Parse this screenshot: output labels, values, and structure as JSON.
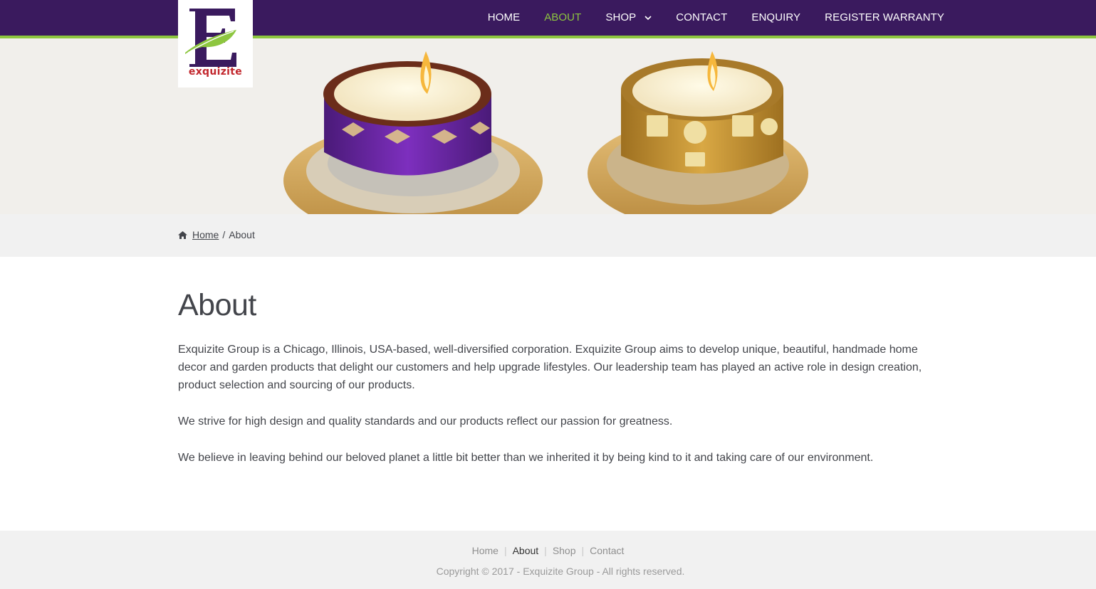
{
  "brand": {
    "name": "exquizite",
    "colors": {
      "header_bg": "#3a1a5e",
      "accent": "#8dc63f",
      "logo_red": "#c2272d",
      "logo_purple": "#3a1a5e"
    }
  },
  "nav": {
    "items": [
      {
        "label": "HOME"
      },
      {
        "label": "ABOUT",
        "active": true
      },
      {
        "label": "SHOP",
        "has_dropdown": true
      },
      {
        "label": "CONTACT"
      },
      {
        "label": "ENQUIRY"
      },
      {
        "label": "REGISTER WARRANTY"
      }
    ]
  },
  "hero": {
    "image": "two decorative tealight candle holders (purple and gold)"
  },
  "breadcrumb": {
    "icon": "home-icon",
    "home": "Home",
    "separator": "/",
    "current": "About"
  },
  "page": {
    "title": "About",
    "paragraphs": [
      "Exquizite Group is a Chicago, Illinois, USA-based, well-diversified corporation. Exquizite Group aims to develop unique, beautiful, handmade home decor and garden products that delight our customers and help upgrade lifestyles. Our leadership team has played an active role in design creation, product selection and sourcing of our products.",
      "We strive for high design and quality standards and our products reflect our passion for greatness.",
      "We believe in leaving behind our beloved planet a little bit better than we inherited it by being kind to it and taking care of our environment."
    ]
  },
  "footer": {
    "links": [
      "Home",
      "About",
      "Shop",
      "Contact"
    ],
    "current": "About",
    "copyright": "Copyright © 2017 - Exquizite Group - All rights reserved."
  }
}
